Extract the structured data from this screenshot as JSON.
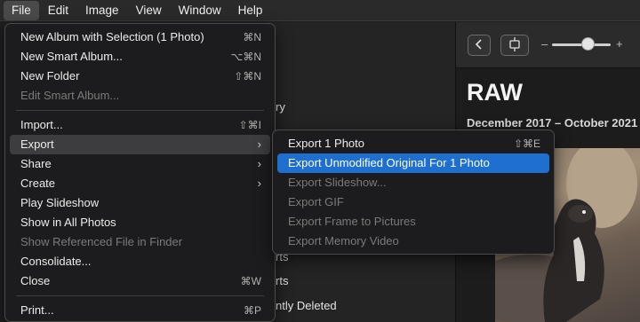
{
  "menubar": [
    {
      "label": "File",
      "active": true
    },
    {
      "label": "Edit",
      "active": false
    },
    {
      "label": "Image",
      "active": false
    },
    {
      "label": "View",
      "active": false
    },
    {
      "label": "Window",
      "active": false
    },
    {
      "label": "Help",
      "active": false
    }
  ],
  "file_menu": {
    "items": [
      {
        "label": "New Album with Selection (1 Photo)",
        "shortcut": "⌘N",
        "enabled": true
      },
      {
        "label": "New Smart Album...",
        "shortcut": "⌥⌘N",
        "enabled": true
      },
      {
        "label": "New Folder",
        "shortcut": "⇧⌘N",
        "enabled": true
      },
      {
        "label": "Edit Smart Album...",
        "shortcut": "",
        "enabled": false
      },
      {
        "label": "Import...",
        "shortcut": "⇧⌘I",
        "enabled": true
      },
      {
        "label": "Export",
        "submenu": true,
        "enabled": true,
        "highlighted": true
      },
      {
        "label": "Share",
        "submenu": true,
        "enabled": true
      },
      {
        "label": "Create",
        "submenu": true,
        "enabled": true
      },
      {
        "label": "Play Slideshow",
        "shortcut": "",
        "enabled": true
      },
      {
        "label": "Show in All Photos",
        "shortcut": "",
        "enabled": true
      },
      {
        "label": "Show Referenced File in Finder",
        "shortcut": "",
        "enabled": false
      },
      {
        "label": "Consolidate...",
        "shortcut": "",
        "enabled": true
      },
      {
        "label": "Close",
        "shortcut": "⌘W",
        "enabled": true
      },
      {
        "label": "Print...",
        "shortcut": "⌘P",
        "enabled": true
      }
    ]
  },
  "export_menu": {
    "items": [
      {
        "label": "Export 1 Photo",
        "shortcut": "⇧⌘E",
        "enabled": true
      },
      {
        "label": "Export Unmodified Original For 1 Photo",
        "shortcut": "",
        "enabled": true,
        "selected": true
      },
      {
        "label": "Export Slideshow...",
        "enabled": false
      },
      {
        "label": "Export GIF",
        "enabled": false
      },
      {
        "label": "Export Frame to Pictures",
        "enabled": false
      },
      {
        "label": "Export Memory Video",
        "enabled": false
      }
    ]
  },
  "sidebar_peek": [
    "ry",
    "rts",
    "rts",
    "ntly Deleted"
  ],
  "main": {
    "title": "RAW",
    "date_range": "December 2017 – October 2021"
  },
  "toolbar": {
    "back_icon": "chevron-left-icon",
    "fit_icon": "fit-view-icon",
    "zoom_minus": "–",
    "zoom_plus": "+",
    "zoom_level": 0.6
  },
  "colors": {
    "selected": "#1f6fd1",
    "menu_bg": "#1c1c1e"
  }
}
